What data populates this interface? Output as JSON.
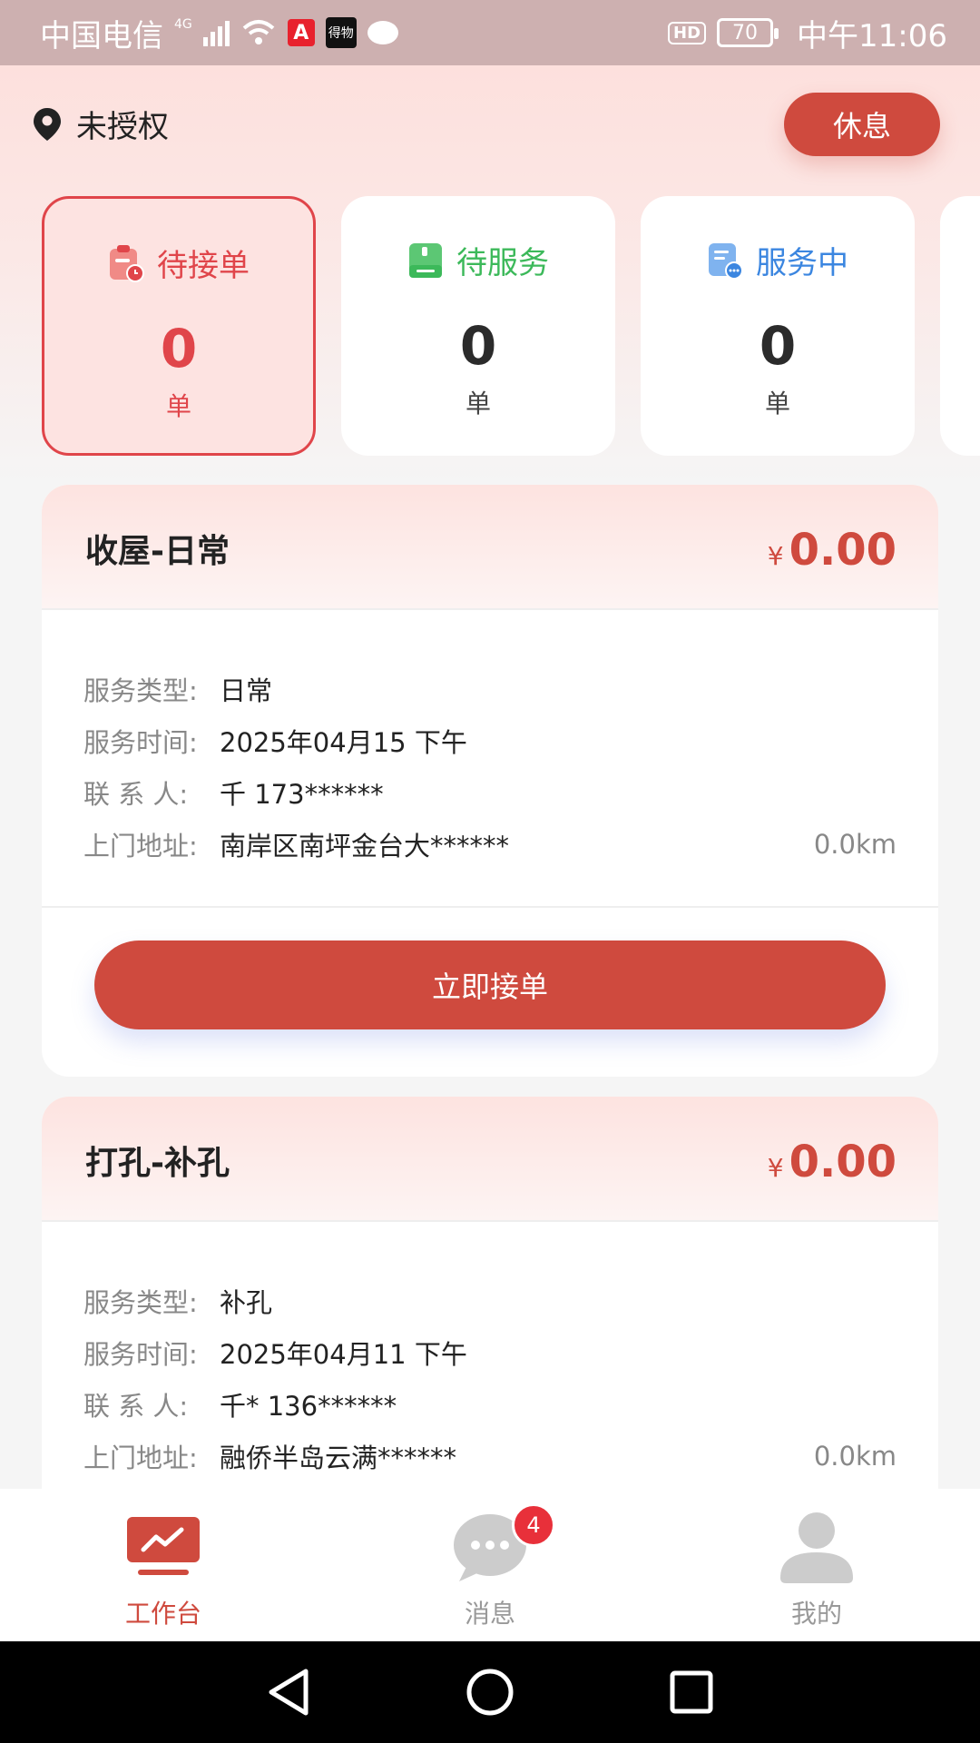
{
  "status_bar": {
    "carrier": "中国电信",
    "network": "4G",
    "app_icon_1": "A",
    "app_icon_2": "得物",
    "hd": "HD",
    "battery": "70",
    "time": "中午11:06"
  },
  "header": {
    "location": "未授权",
    "rest_button": "休息"
  },
  "stats": [
    {
      "label": "待接单",
      "count": "0",
      "unit": "单",
      "color": "#e0454a",
      "icon": "clipboard-clock-icon"
    },
    {
      "label": "待服务",
      "count": "0",
      "unit": "单",
      "color": "#3cb95a",
      "icon": "book-icon"
    },
    {
      "label": "服务中",
      "count": "0",
      "unit": "单",
      "color": "#3b86e0",
      "icon": "document-chat-icon"
    }
  ],
  "labels": {
    "type": "服务类型:",
    "time": "服务时间:",
    "contact": "联 系 人:",
    "address": "上门地址:"
  },
  "orders": [
    {
      "title": "收屋-日常",
      "currency": "¥",
      "price": "0.00",
      "type": "日常",
      "time": "2025年04月15 下午",
      "contact": "千 173******",
      "address": "南岸区南坪金台大******",
      "distance": "0.0km",
      "action": "立即接单"
    },
    {
      "title": "打孔-补孔",
      "currency": "¥",
      "price": "0.00",
      "type": "补孔",
      "time": "2025年04月11 下午",
      "contact": "千* 136******",
      "address": "融侨半岛云满******",
      "distance": "0.0km"
    }
  ],
  "tabbar": {
    "items": [
      {
        "label": "工作台",
        "icon": "chart-board-icon"
      },
      {
        "label": "消息",
        "icon": "chat-bubble-icon",
        "badge": "4"
      },
      {
        "label": "我的",
        "icon": "user-icon"
      }
    ]
  },
  "colors": {
    "accent": "#cf4a3e",
    "green": "#3cb95a",
    "blue": "#3b86e0"
  }
}
